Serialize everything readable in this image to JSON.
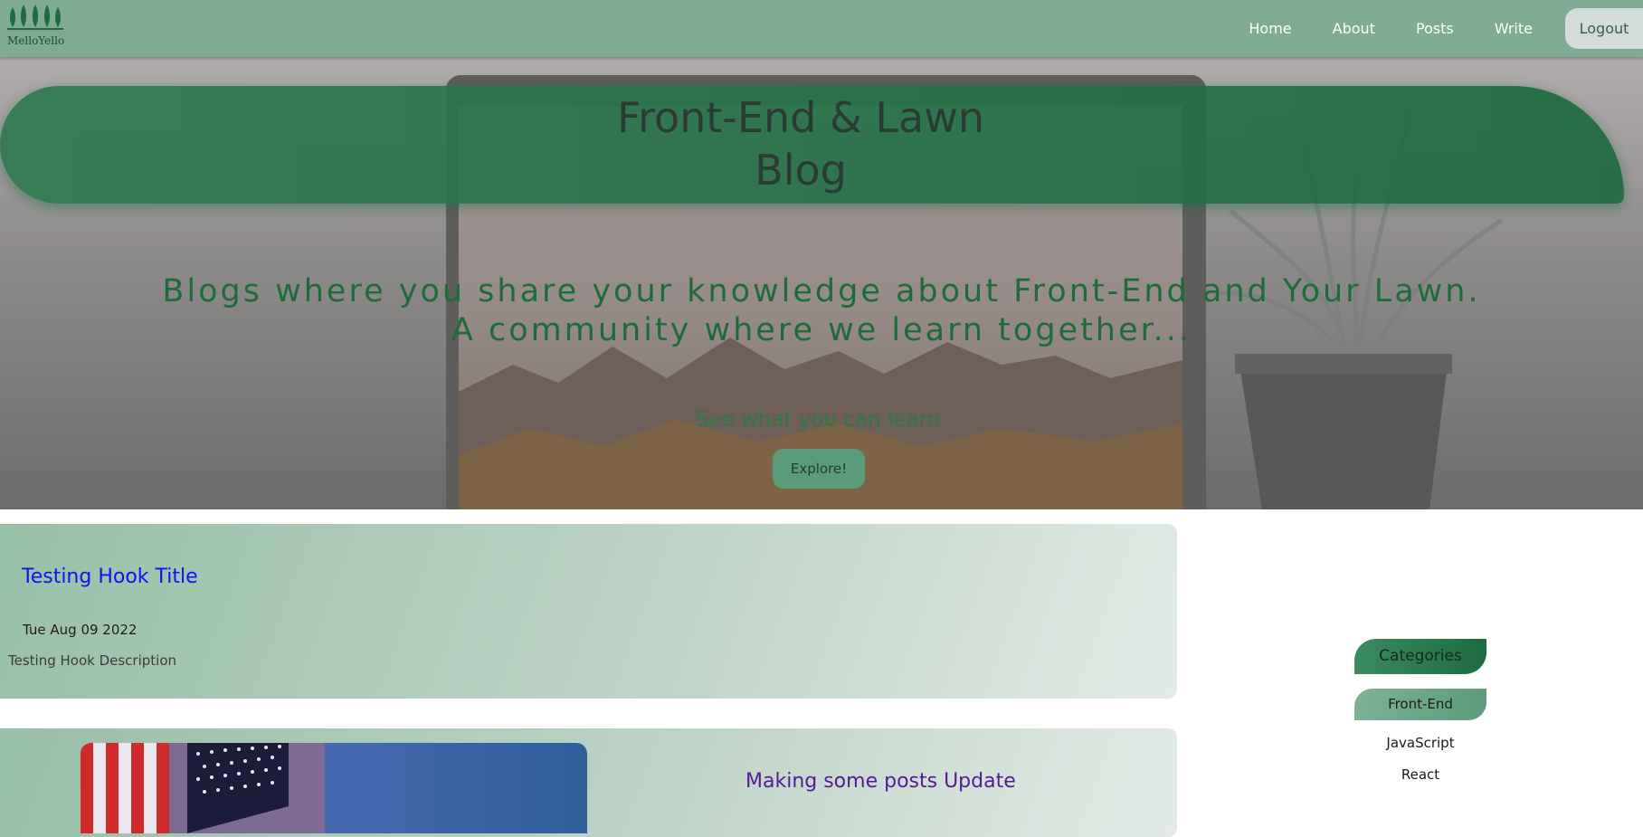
{
  "navbar": {
    "logo_text": "MelloYello",
    "links": [
      "Home",
      "About",
      "Posts",
      "Write"
    ],
    "logout": "Logout"
  },
  "hero": {
    "title_line1": "Front-End & Lawn",
    "title_line2": "Blog",
    "tagline_line1": "Blogs where you share your knowledge about Front-End and Your Lawn.",
    "tagline_line2": "A community where we learn together...",
    "subheading": "See what you can learn",
    "explore_button": "Explore!"
  },
  "posts": [
    {
      "title": "Testing Hook Title",
      "date": "Tue Aug 09 2022",
      "description": "Testing Hook Description"
    },
    {
      "title": "Making some posts Update"
    }
  ],
  "sidebar": {
    "header": "Categories",
    "active_category": "Front-End",
    "categories": [
      "JavaScript",
      "React"
    ]
  },
  "colors": {
    "navbar": "#80aa92",
    "brand_green": "#1e6b40",
    "post_title": "#1212ee",
    "visited_title": "#55199a"
  }
}
